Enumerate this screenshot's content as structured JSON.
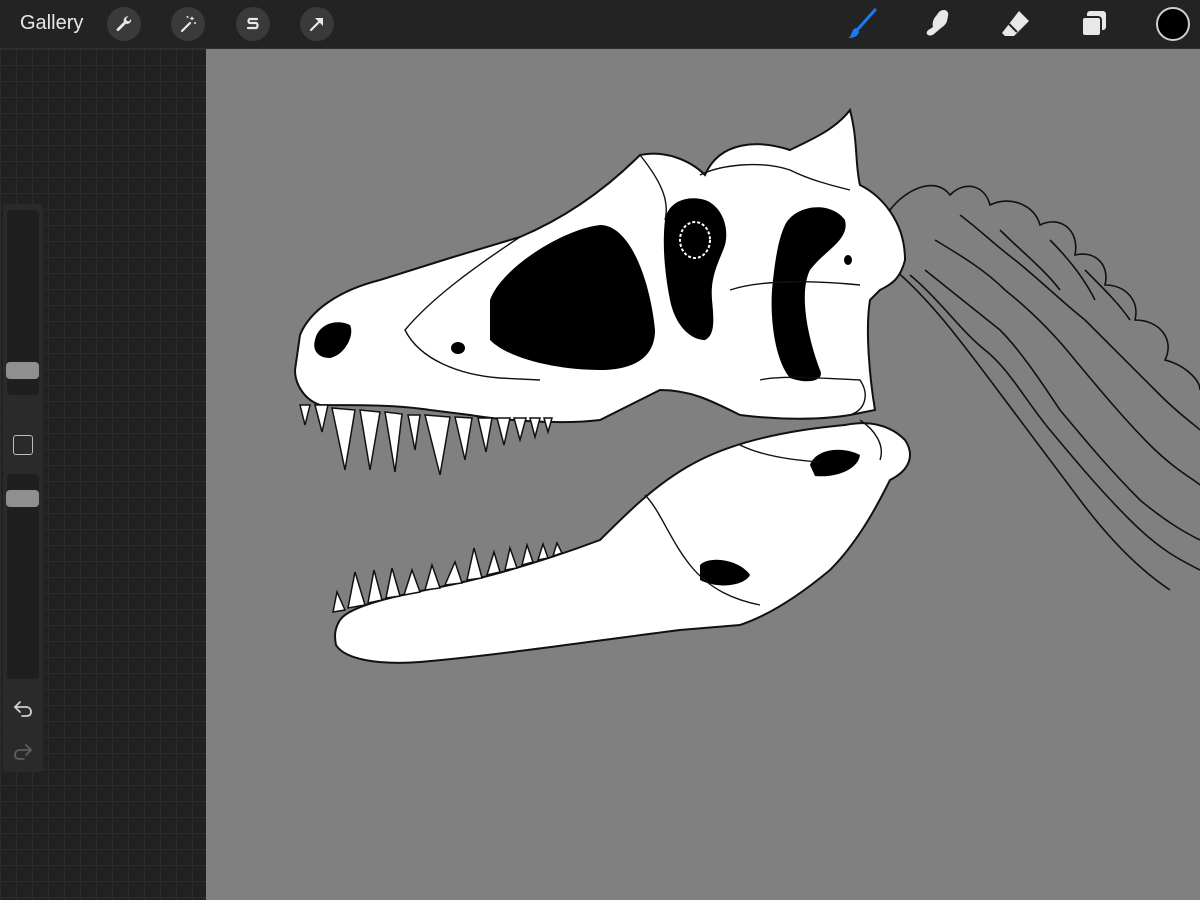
{
  "topbar": {
    "gallery_label": "Gallery",
    "left_tools": [
      "wrench-icon",
      "magic-wand-icon",
      "selection-s-icon",
      "transform-arrow-icon"
    ],
    "right_tools": [
      "brush-icon",
      "smudge-icon",
      "eraser-icon",
      "layers-icon"
    ],
    "active_tool": "brush-icon",
    "active_color": "#000000",
    "accent_color": "#1a7cf5"
  },
  "sidebar": {
    "brush_size_level": 0.15,
    "opacity_level": 0.93,
    "tools": [
      "modify-square-icon",
      "undo-icon",
      "redo-icon"
    ]
  },
  "canvas": {
    "background_color": "#808080",
    "subject": "drawing-of-theropod-skull"
  }
}
